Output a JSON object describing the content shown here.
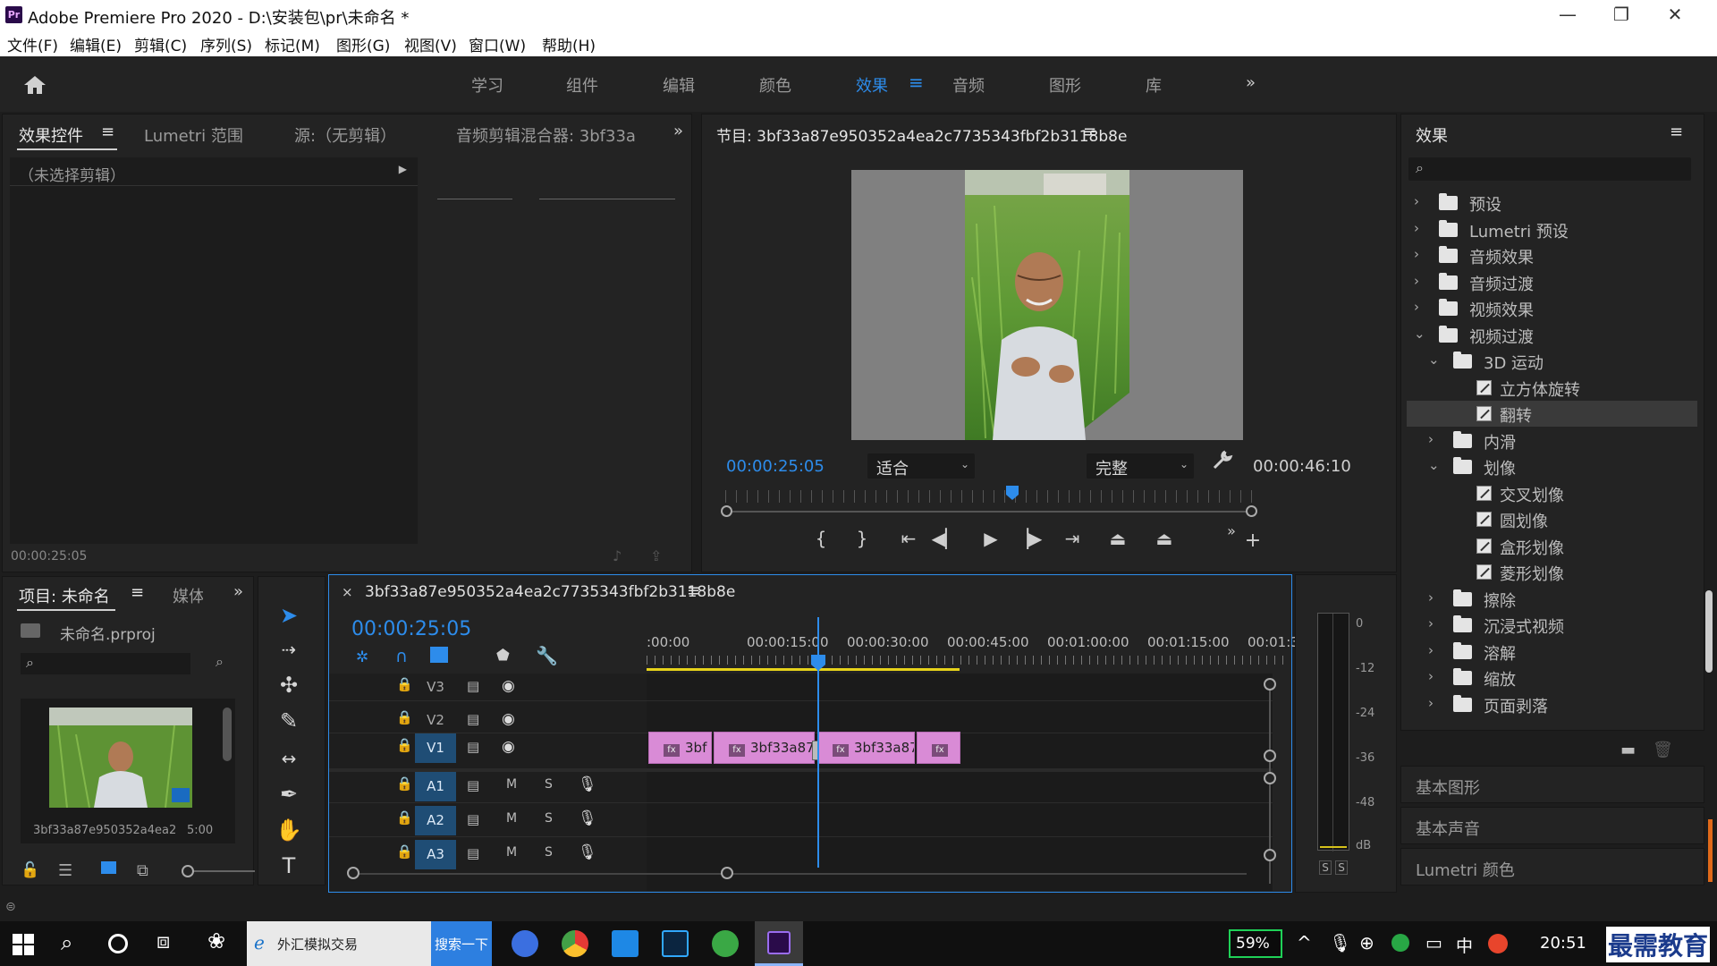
{
  "window": {
    "title": "Adobe Premiere Pro 2020 - D:\\安装包\\pr\\未命名 *",
    "logo_text": "Pr"
  },
  "menu": [
    "文件(F)",
    "编辑(E)",
    "剪辑(C)",
    "序列(S)",
    "标记(M)",
    "图形(G)",
    "视图(V)",
    "窗口(W)",
    "帮助(H)"
  ],
  "workspaces": {
    "items": [
      "学习",
      "组件",
      "编辑",
      "颜色",
      "效果",
      "音频",
      "图形",
      "库"
    ],
    "active": "效果",
    "more": "»"
  },
  "source_panel": {
    "tabs": [
      "效果控件",
      "Lumetri 范围",
      "源:（无剪辑）",
      "音频剪辑混合器: 3bf33a"
    ],
    "active_tab": "效果控件",
    "no_clip": "（未选择剪辑）",
    "timecode": "00:00:25:05"
  },
  "program_monitor": {
    "title": "节目: 3bf33a87e950352a4ea2c7735343fbf2b3118b8e",
    "current_timecode": "00:00:25:05",
    "zoom": "适合",
    "quality": "完整",
    "duration": "00:00:46:10",
    "playhead_fraction": 0.54
  },
  "effects_panel": {
    "title": "效果",
    "tree": [
      {
        "label": "预设",
        "level": 0,
        "type": "folder-star",
        "expanded": false
      },
      {
        "label": "Lumetri 预设",
        "level": 0,
        "type": "folder-star",
        "expanded": false
      },
      {
        "label": "音频效果",
        "level": 0,
        "type": "folder",
        "expanded": false
      },
      {
        "label": "音频过渡",
        "level": 0,
        "type": "folder",
        "expanded": false
      },
      {
        "label": "视频效果",
        "level": 0,
        "type": "folder",
        "expanded": false
      },
      {
        "label": "视频过渡",
        "level": 0,
        "type": "folder",
        "expanded": true
      },
      {
        "label": "3D 运动",
        "level": 1,
        "type": "folder",
        "expanded": true
      },
      {
        "label": "立方体旋转",
        "level": 2,
        "type": "effect"
      },
      {
        "label": "翻转",
        "level": 2,
        "type": "effect",
        "selected": true
      },
      {
        "label": "内滑",
        "level": 1,
        "type": "folder",
        "expanded": false
      },
      {
        "label": "划像",
        "level": 1,
        "type": "folder",
        "expanded": true
      },
      {
        "label": "交叉划像",
        "level": 2,
        "type": "effect"
      },
      {
        "label": "圆划像",
        "level": 2,
        "type": "effect"
      },
      {
        "label": "盒形划像",
        "level": 2,
        "type": "effect"
      },
      {
        "label": "菱形划像",
        "level": 2,
        "type": "effect"
      },
      {
        "label": "擦除",
        "level": 1,
        "type": "folder",
        "expanded": false
      },
      {
        "label": "沉浸式视频",
        "level": 1,
        "type": "folder",
        "expanded": false
      },
      {
        "label": "溶解",
        "level": 1,
        "type": "folder",
        "expanded": false
      },
      {
        "label": "缩放",
        "level": 1,
        "type": "folder",
        "expanded": false
      },
      {
        "label": "页面剥落",
        "level": 1,
        "type": "folder",
        "expanded": false
      }
    ],
    "sections": [
      "基本图形",
      "基本声音",
      "Lumetri 颜色"
    ]
  },
  "project_panel": {
    "tabs": [
      "项目: 未命名",
      "媒体"
    ],
    "file": "未命名.prproj",
    "clip_name": "3bf33a87e950352a4ea2",
    "clip_duration": "5:00"
  },
  "timeline": {
    "sequence": "3bf33a87e950352a4ea2c7735343fbf2b3118b8e",
    "timecode": "00:00:25:05",
    "ruler": [
      ":00:00",
      "00:00:15:00",
      "00:00:30:00",
      "00:00:45:00",
      "00:01:00:00",
      "00:01:15:00",
      "00:01:3"
    ],
    "video_tracks": [
      "V3",
      "V2",
      "V1"
    ],
    "audio_tracks": [
      "A1",
      "A2",
      "A3"
    ],
    "track_buttons": {
      "mute": "M",
      "solo": "S"
    },
    "clips": [
      "3bf",
      "3bf33a87",
      "3bf33a87",
      ""
    ]
  },
  "audio_meter": {
    "labels": [
      "0",
      "-12",
      "-24",
      "-36",
      "-48",
      "dB"
    ],
    "solo": [
      "S",
      "S"
    ]
  },
  "taskbar": {
    "browser_tab": "外汇模拟交易",
    "search_button": "搜索一下",
    "battery": "59%",
    "ime": "中",
    "time": "20:51",
    "watermark": "最需教育"
  }
}
